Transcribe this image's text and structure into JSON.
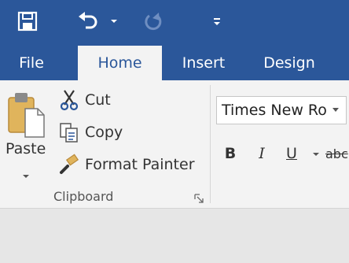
{
  "quick_access": {
    "save_icon": "save-icon",
    "undo_icon": "undo-icon",
    "redo_icon": "redo-icon",
    "customize_icon": "customize-qat-icon"
  },
  "tabs": [
    {
      "label": "File",
      "active": false
    },
    {
      "label": "Home",
      "active": true
    },
    {
      "label": "Insert",
      "active": false
    },
    {
      "label": "Design",
      "active": false
    }
  ],
  "clipboard": {
    "paste_label": "Paste",
    "cut_label": "Cut",
    "copy_label": "Copy",
    "format_painter_label": "Format Painter",
    "group_label": "Clipboard"
  },
  "font": {
    "font_name": "Times New Ro",
    "bold_label": "B",
    "italic_label": "I",
    "underline_label": "U",
    "strike_label": "abc"
  },
  "colors": {
    "brand_blue": "#2b579a",
    "ribbon_bg": "#f3f3f3",
    "body_bg": "#e6e6e6"
  }
}
